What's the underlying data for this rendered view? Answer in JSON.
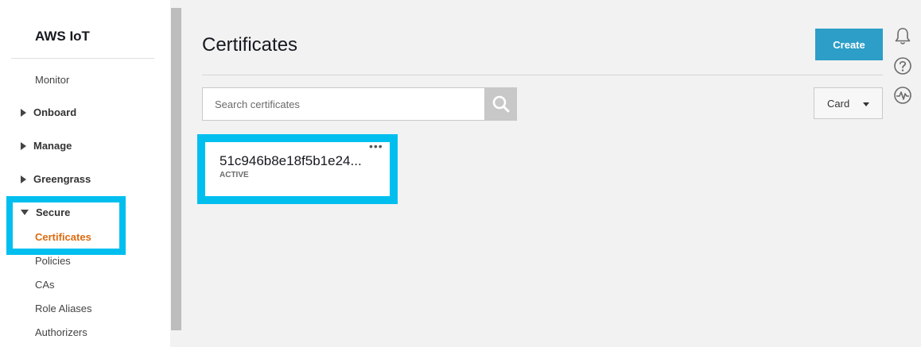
{
  "sidebar": {
    "app_title": "AWS IoT",
    "monitor": "Monitor",
    "groups": {
      "onboard": "Onboard",
      "manage": "Manage",
      "greengrass": "Greengrass",
      "secure": "Secure"
    },
    "secure_items": {
      "certificates": "Certificates",
      "policies": "Policies",
      "cas": "CAs",
      "role_aliases": "Role Aliases",
      "authorizers": "Authorizers"
    }
  },
  "main": {
    "title": "Certificates",
    "create_label": "Create",
    "search_placeholder": "Search certificates",
    "view_select": "Card",
    "card": {
      "id": "51c946b8e18f5b1e24...",
      "status": "ACTIVE",
      "menu": "•••"
    }
  },
  "colors": {
    "accent": "#2c9ec7",
    "active_nav": "#dd6b10",
    "highlight": "#00bfef"
  },
  "icons": [
    "bell-icon",
    "help-icon",
    "activity-icon",
    "search-icon"
  ]
}
